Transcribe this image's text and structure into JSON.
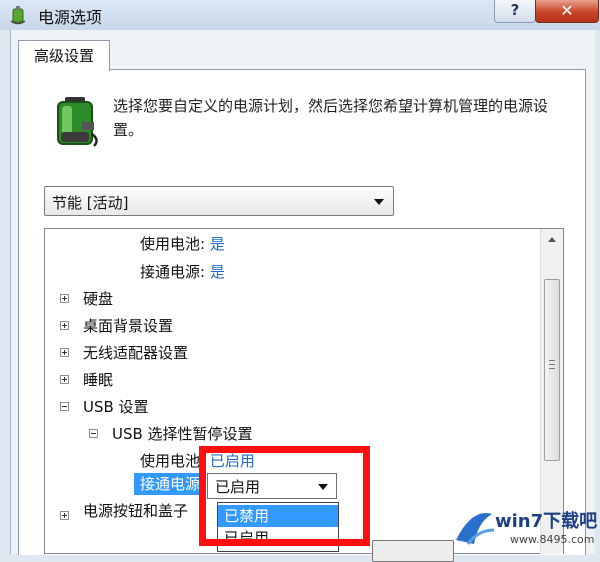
{
  "window": {
    "title": "电源选项",
    "help_label": "?",
    "close_label": "✕"
  },
  "tab": {
    "label": "高级设置"
  },
  "description": "选择您要自定义的电源计划，然后选择您希望计算机管理的电源设置。",
  "plan_select": {
    "value": "节能 [活动]"
  },
  "tree": {
    "on_battery_label": "使用电池:",
    "on_battery_value": "是",
    "plugged_in_label": "接通电源:",
    "plugged_in_value": "是",
    "hard_disk": "硬盘",
    "desktop_background": "桌面背景设置",
    "wireless_adapter": "无线适配器设置",
    "sleep": "睡眠",
    "usb_settings": "USB 设置",
    "usb_selective_suspend": "USB 选择性暂停设置",
    "usb_on_battery_label": "使用电池:",
    "usb_on_battery_value": "已启用",
    "usb_plugged_in_label": "接通电源:",
    "usb_plugged_in_value": "已启用",
    "power_buttons_partial": "电源按钮和盖子"
  },
  "combo_options": [
    "已禁用",
    "已启用"
  ],
  "watermark": {
    "brand": "win7下载吧",
    "url": "www.8495.com"
  },
  "colors": {
    "accent": "#3399ff",
    "value_blue": "#1f6bc9",
    "highlight_box": "#ff1010"
  }
}
